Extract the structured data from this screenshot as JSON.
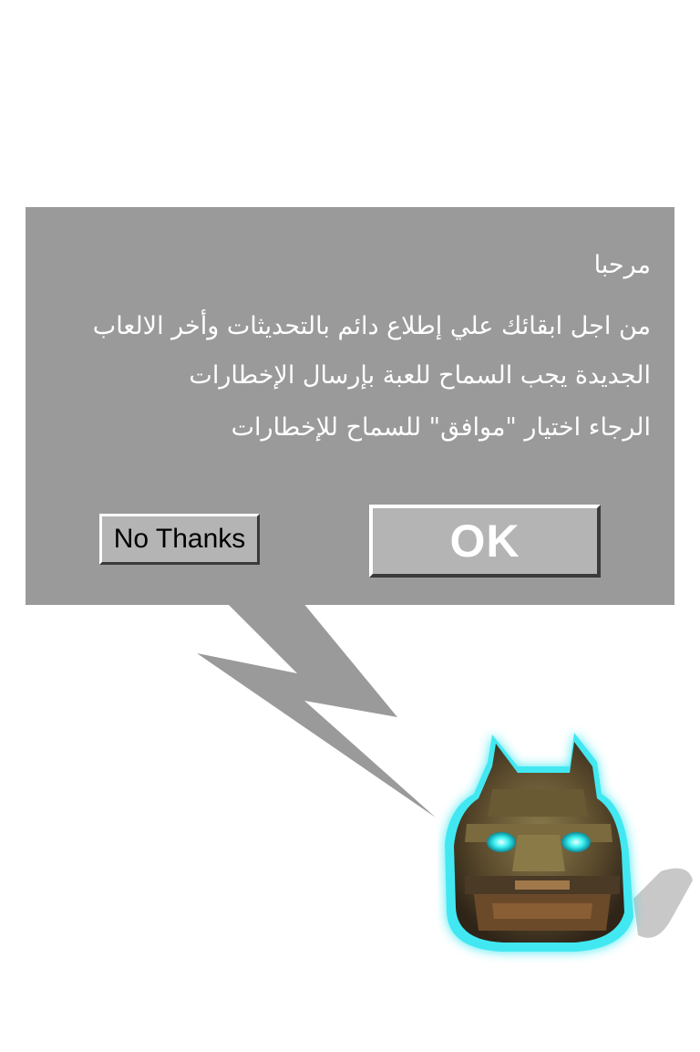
{
  "dialog": {
    "greeting": "مرحبا",
    "message": "من اجل ابقائك علي إطلاع دائم بالتحديثات وأخر الالعاب الجديدة يجب السماح للعبة بإرسال الإخطارات",
    "instruction": "الرجاء اختيار \"موافق\" للسماح للإخطارات",
    "no_button_label": "No Thanks",
    "ok_button_label": "OK"
  },
  "colors": {
    "panel": "#9a9a9a",
    "button_face": "#b4b4b4",
    "text": "#ffffff",
    "mascot_glow": "#2ee6f0"
  },
  "mascot": {
    "icon": "stone-idol-mascot-icon"
  }
}
